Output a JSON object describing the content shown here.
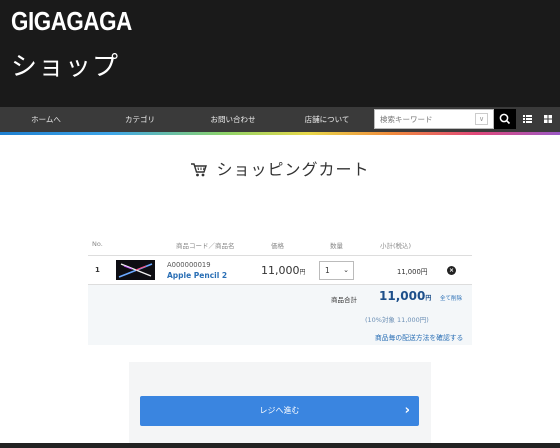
{
  "header": {
    "logo": "GIGAGAGA",
    "shop_title": "ショップ"
  },
  "nav": {
    "items": [
      {
        "label": "ホームへ"
      },
      {
        "label": "カテゴリ"
      },
      {
        "label": "お問い合わせ"
      },
      {
        "label": "店舗について"
      }
    ],
    "search_placeholder": "検索キーワード"
  },
  "page": {
    "title": "ショッピングカート"
  },
  "cart": {
    "headers": {
      "no": "No.",
      "code_name": "商品コード／商品名",
      "price": "価格",
      "qty": "数量",
      "subtotal": "小計(税込)"
    },
    "items": [
      {
        "no": "1",
        "code": "A000000019",
        "name": "Apple Pencil 2",
        "price": "11,000",
        "price_unit": "円",
        "qty": "1",
        "subtotal": "11,000円"
      }
    ],
    "summary": {
      "total_label": "商品合計",
      "total_value": "11,000",
      "total_unit": "円",
      "clear_all": "全て削除",
      "tax_note": "(10%対象 11,000円)",
      "shipping_link": "商品毎の配送方法を確認する"
    },
    "checkout_label": "レジへ進む"
  },
  "colors": {
    "header_bg": "#1a1a1a",
    "accent": "#3a85e0",
    "link": "#2a6fb5"
  }
}
